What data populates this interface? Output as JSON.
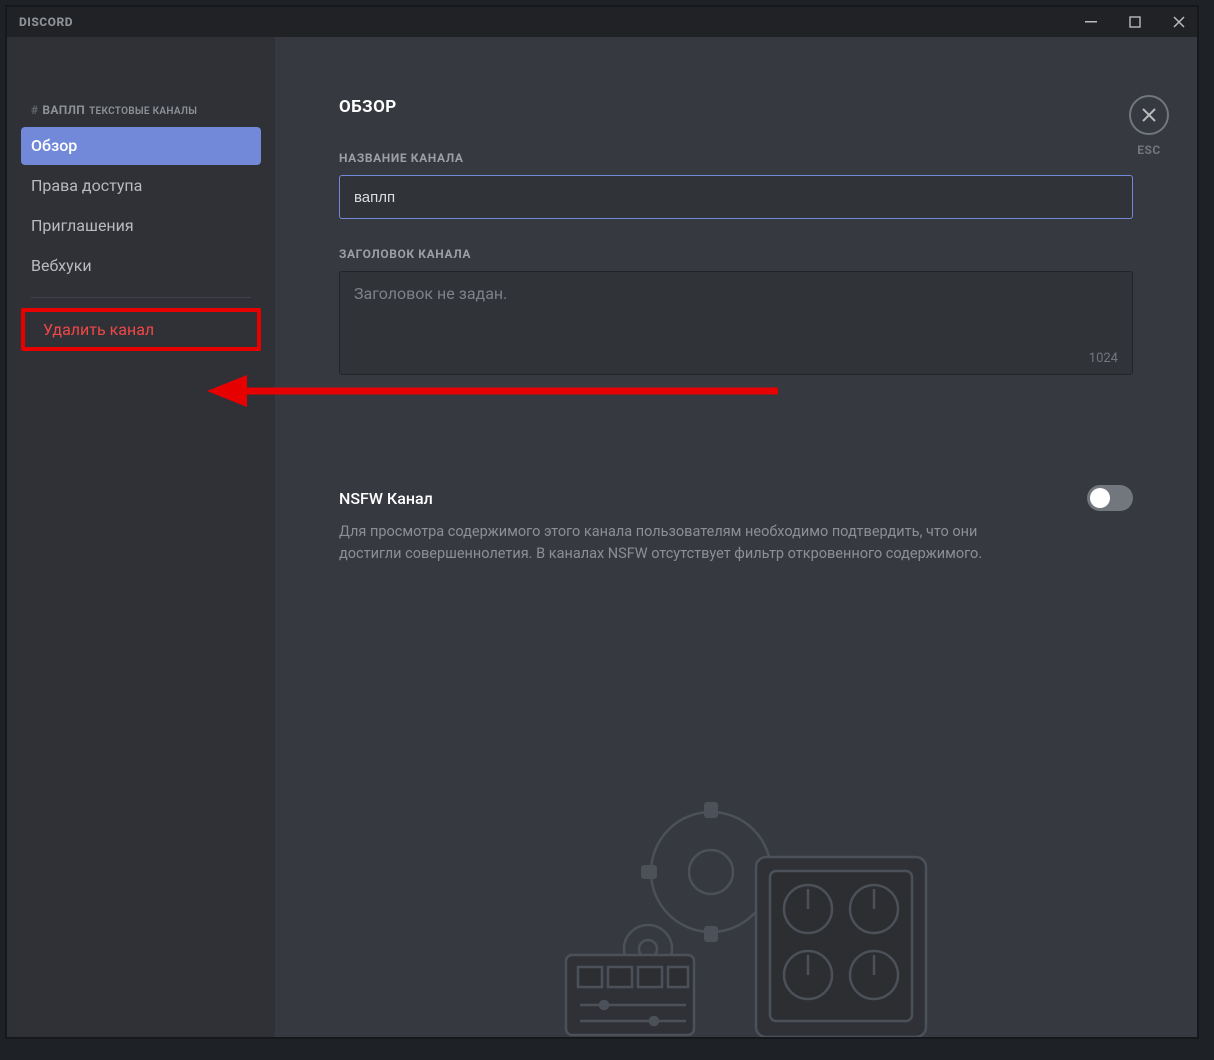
{
  "titlebar": {
    "logo": "DISCORD"
  },
  "sidebar": {
    "hash": "#",
    "channel_name_caps": "ВАПЛП",
    "category_label": "ТЕКСТОВЫЕ КАНАЛЫ",
    "items": [
      {
        "label": "Обзор"
      },
      {
        "label": "Права доступа"
      },
      {
        "label": "Приглашения"
      },
      {
        "label": "Вебхуки"
      }
    ],
    "delete_label": "Удалить канал"
  },
  "main": {
    "title": "ОБЗОР",
    "channel_name_label": "НАЗВАНИЕ КАНАЛА",
    "channel_name_value": "ваплп",
    "topic_label": "ЗАГОЛОВОК КАНАЛА",
    "topic_placeholder": "Заголовок не задан.",
    "topic_char_limit": "1024",
    "nsfw_title": "NSFW Канал",
    "nsfw_desc": "Для просмотра содержимого этого канала пользователям необходимо подтвердить, что они достигли совершеннолетия. В каналах NSFW отсутствует фильтр откровенного содержимого."
  },
  "close": {
    "label": "ESC"
  }
}
